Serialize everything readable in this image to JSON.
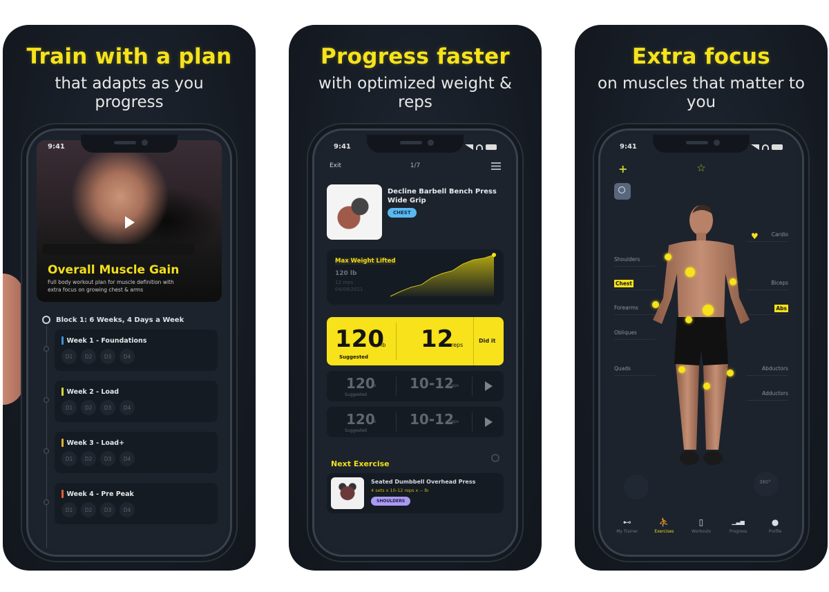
{
  "panels": [
    {
      "headline": "Train with a plan",
      "subline": "that adapts as you progress",
      "status_time": "9:41",
      "plan": {
        "title": "Overall Muscle Gain",
        "description": "Full body workout plan for muscle definition with extra focus on growing chest & arms"
      },
      "block": {
        "title": "Block 1: 6 Weeks, 4 Days a Week"
      },
      "weeks": [
        {
          "title": "Week 1 - Foundations",
          "color": "#3f8fd8",
          "days": [
            "D1",
            "D2",
            "D3",
            "D4"
          ]
        },
        {
          "title": "Week 2 - Load",
          "color": "#d8d838",
          "days": [
            "D1",
            "D2",
            "D3",
            "D4"
          ]
        },
        {
          "title": "Week 3 - Load+",
          "color": "#e0b030",
          "days": [
            "D1",
            "D2",
            "D3",
            "D4"
          ]
        },
        {
          "title": "Week 4 - Pre Peak",
          "color": "#e0603a",
          "days": [
            "D1",
            "D2",
            "D3",
            "D4"
          ]
        }
      ]
    },
    {
      "headline": "Progress faster",
      "subline": "with optimized weight & reps",
      "status_time": "9:41",
      "topbar": {
        "exit": "Exit",
        "counter": "1/7"
      },
      "exercise": {
        "name": "Decline Barbell Bench Press Wide Grip",
        "tag": "CHEST"
      },
      "max_weight": {
        "title": "Max Weight Lifted",
        "value": "120 lb",
        "detail": "12 reps",
        "date": "04/09/2021",
        "trend": [
          0,
          0.12,
          0.22,
          0.28,
          0.45,
          0.55,
          0.62,
          0.78,
          0.88,
          0.92,
          1.0
        ]
      },
      "sets": [
        {
          "weight": "120",
          "weight_unit": "lb",
          "weight_sub": "Suggested",
          "reps": "12",
          "reps_unit": "reps",
          "action": "Did it",
          "active": true
        },
        {
          "weight": "120",
          "weight_unit": "lb",
          "weight_sub": "Suggested",
          "reps": "10-12",
          "reps_unit": "reps",
          "active": false
        },
        {
          "weight": "120",
          "weight_unit": "lb",
          "weight_sub": "Suggested",
          "reps": "10-12",
          "reps_unit": "reps",
          "active": false
        }
      ],
      "next": {
        "heading": "Next Exercise",
        "name": "Seated Dumbbell Overhead Press",
        "meta": "4 sets x 10-12 reps x -- lb",
        "tag": "SHOULDERS"
      }
    },
    {
      "headline": "Extra focus",
      "subline": "on muscles that matter to you",
      "status_time": "9:41",
      "muscles_left": [
        "Shoulders",
        "Chest",
        "Forearms",
        "Obliques",
        "Quads"
      ],
      "muscles_right": [
        "Cardio",
        "Biceps",
        "Abs",
        "Abductors",
        "Adductors"
      ],
      "highlighted": [
        "Chest",
        "Abs"
      ],
      "rotate_label": "360°",
      "tabs": [
        {
          "label": "My Trainer",
          "icon": "dumbbell-icon"
        },
        {
          "label": "Exercises",
          "icon": "exercises-icon",
          "active": true
        },
        {
          "label": "Workouts",
          "icon": "workouts-icon"
        },
        {
          "label": "Progress",
          "icon": "progress-icon"
        },
        {
          "label": "Profile",
          "icon": "profile-icon"
        }
      ]
    }
  ],
  "colors": {
    "accent": "#f7e21b",
    "panel_bg": "#151a22",
    "card_bg": "#151b23"
  }
}
